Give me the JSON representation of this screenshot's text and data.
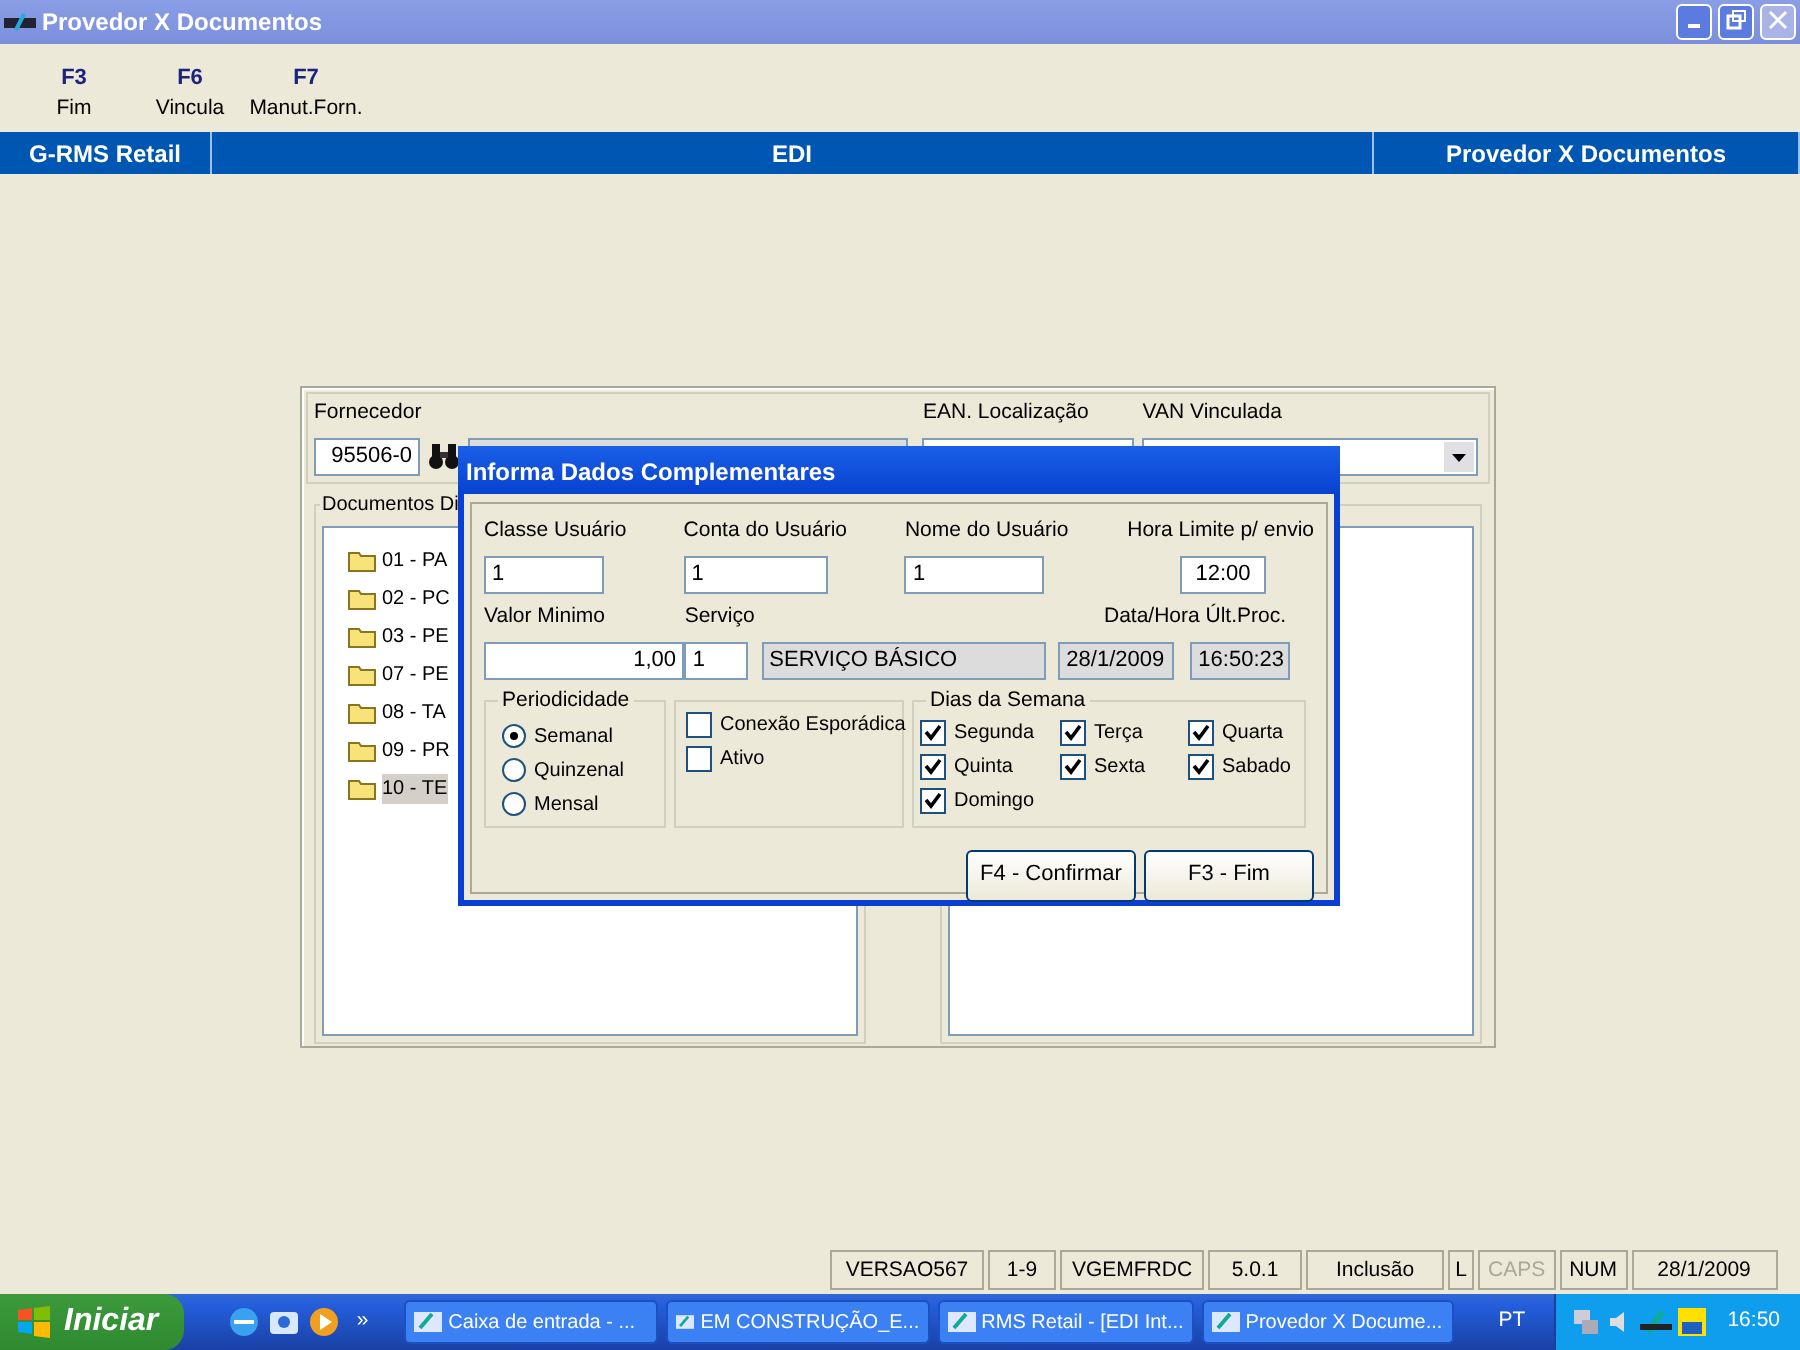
{
  "window": {
    "title": "Provedor X Documentos"
  },
  "toolbar": [
    {
      "key": "F3",
      "label": "Fim"
    },
    {
      "key": "F6",
      "label": "Vincula"
    },
    {
      "key": "F7",
      "label": "Manut.Forn."
    }
  ],
  "header": {
    "left": "G-RMS Retail",
    "center": "EDI",
    "right": "Provedor X Documentos"
  },
  "supplier": {
    "label": "Fornecedor",
    "code": "95506-0",
    "ean_label": "EAN. Localização",
    "van_label": "VAN Vinculada"
  },
  "documents": {
    "title": "Documentos Di",
    "items": [
      {
        "label": "01 - PA",
        "selected": false
      },
      {
        "label": "02 - PC",
        "selected": false
      },
      {
        "label": "03 - PE",
        "selected": false
      },
      {
        "label": "07 - PE",
        "selected": false
      },
      {
        "label": "08 - TA",
        "selected": false
      },
      {
        "label": "09 - PR",
        "selected": false
      },
      {
        "label": "10 - TE",
        "selected": true
      }
    ]
  },
  "dialog": {
    "title": "Informa Dados Complementares",
    "row1": [
      {
        "label": "Classe Usuário",
        "value": "1"
      },
      {
        "label": "Conta do Usuário",
        "value": "1"
      },
      {
        "label": "Nome do Usuário",
        "value": "1"
      },
      {
        "label": "Hora Limite p/ envio",
        "value": "12:00"
      }
    ],
    "valor_minimo": {
      "label": "Valor Minimo",
      "value": "1,00"
    },
    "servico": {
      "label": "Serviço",
      "code": "1",
      "description": "SERVIÇO BÁSICO"
    },
    "last_proc": {
      "label": "Data/Hora Últ.Proc.",
      "date": "28/1/2009",
      "time": "16:50:23"
    },
    "periodicidade": {
      "title": "Periodicidade",
      "options": [
        {
          "label": "Semanal",
          "selected": true
        },
        {
          "label": "Quinzenal",
          "selected": false
        },
        {
          "label": "Mensal",
          "selected": false
        }
      ]
    },
    "flags": [
      {
        "label": "Conexão Esporádica",
        "checked": false
      },
      {
        "label": "Ativo",
        "checked": false
      }
    ],
    "dias": {
      "title": "Dias da Semana",
      "days": [
        {
          "label": "Segunda",
          "checked": true
        },
        {
          "label": "Terça",
          "checked": true
        },
        {
          "label": "Quarta",
          "checked": true
        },
        {
          "label": "Quinta",
          "checked": true
        },
        {
          "label": "Sexta",
          "checked": true
        },
        {
          "label": "Sabado",
          "checked": true
        },
        {
          "label": "Domingo",
          "checked": true
        }
      ]
    },
    "buttons": [
      "F4 - Confirmar",
      "F3 - Fim"
    ]
  },
  "status_bar": [
    {
      "text": "VERSAO567",
      "disabled": false
    },
    {
      "text": "1-9",
      "disabled": false
    },
    {
      "text": "VGEMFRDC",
      "disabled": false
    },
    {
      "text": "5.0.1",
      "disabled": false
    },
    {
      "text": "Inclusão",
      "disabled": false
    },
    {
      "text": "L",
      "disabled": false
    },
    {
      "text": "CAPS",
      "disabled": true
    },
    {
      "text": "NUM",
      "disabled": false
    },
    {
      "text": "28/1/2009",
      "disabled": false
    }
  ],
  "taskbar": {
    "start": "Iniciar",
    "chevron": "»",
    "tasks": [
      "Caixa de entrada - ...",
      "EM CONSTRUÇÃO_E...",
      "RMS Retail - [EDI Int...",
      "Provedor X Docume..."
    ],
    "language": "PT",
    "clock": "16:50"
  }
}
